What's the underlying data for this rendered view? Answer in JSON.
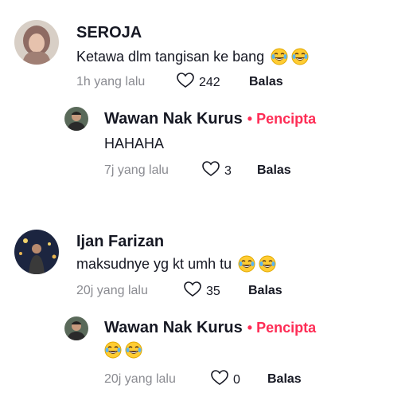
{
  "comments": [
    {
      "username": "SEROJA",
      "text": "Ketawa dlm tangisan ke bang",
      "emojis": [
        "tears-of-joy",
        "tears-of-joy"
      ],
      "time": "1h yang lalu",
      "likes": "242",
      "reply_label": "Balas",
      "reply": {
        "username": "Wawan Nak Kurus",
        "creator_label": "Pencipta",
        "text": "HAHAHA",
        "time": "7j yang lalu",
        "likes": "3",
        "reply_label": "Balas"
      }
    },
    {
      "username": "Ijan Farizan",
      "text": "maksudnye yg kt umh tu",
      "emojis": [
        "tears-of-joy",
        "tears-of-joy"
      ],
      "time": "20j yang lalu",
      "likes": "35",
      "reply_label": "Balas",
      "reply": {
        "username": "Wawan Nak Kurus",
        "creator_label": "Pencipta",
        "text": "",
        "emojis": [
          "tears-of-joy",
          "tears-of-joy"
        ],
        "time": "20j yang lalu",
        "likes": "0",
        "reply_label": "Balas"
      }
    }
  ],
  "colors": {
    "creator": "#fe2c55",
    "meta": "#8a8b91",
    "text": "#161823"
  }
}
